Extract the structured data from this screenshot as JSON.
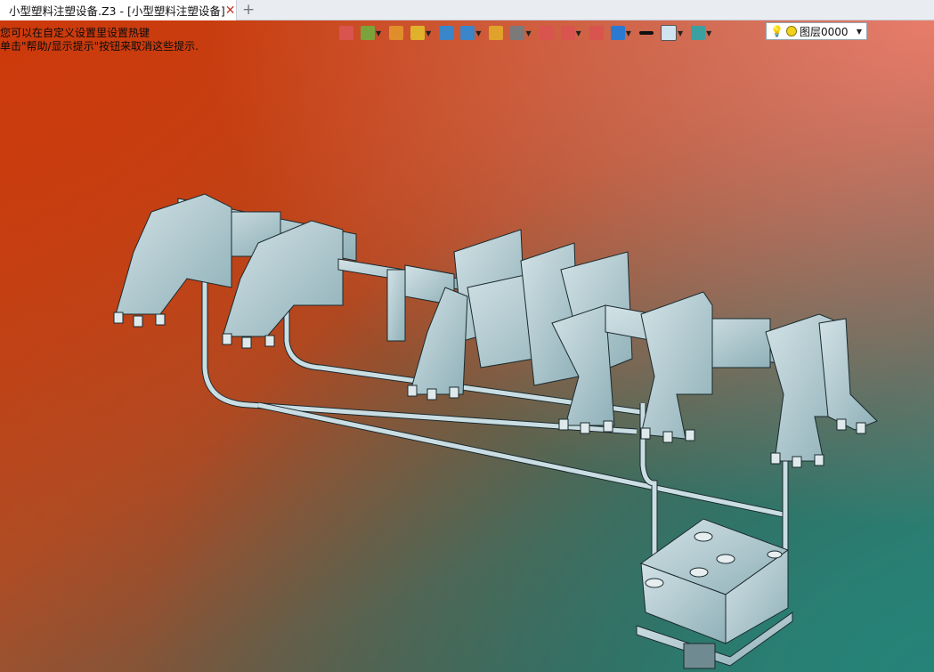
{
  "tab": {
    "title": "小型塑料注塑设备.Z3 - [小型塑料注塑设备]",
    "close_glyph": "✕"
  },
  "new_tab_glyph": "+",
  "hints": {
    "line1": "您可以在自定义设置里设置热键",
    "line2": "单击\"帮助/显示提示\"按钮来取消这些提示."
  },
  "toolbar": {
    "items": [
      {
        "icon": "insert-component-icon",
        "color": "#d9534f"
      },
      {
        "icon": "move-icon",
        "color": "#7aa33b"
      },
      {
        "icon": "pencil-icon",
        "color": "#e08e2b"
      },
      {
        "icon": "solid-block-icon",
        "color": "#e0b22b"
      },
      {
        "icon": "cube-icon",
        "color": "#3a86c8"
      },
      {
        "icon": "view-cube-icon",
        "color": "#3a86c8"
      },
      {
        "icon": "render-mode-icon",
        "color": "#e0a22b"
      },
      {
        "icon": "zoom-icon",
        "color": "#7a7a7a"
      },
      {
        "icon": "target-icon",
        "color": "#d9534f"
      },
      {
        "icon": "frame-icon",
        "color": "#d9534f"
      },
      {
        "icon": "bracket-icon",
        "color": "#d9534f"
      },
      {
        "icon": "display-icon",
        "color": "#2b7ad0"
      },
      {
        "icon": "line-color-icon",
        "color": "#111111"
      },
      {
        "icon": "face-color-icon",
        "color": "#cfe3f0"
      },
      {
        "icon": "layer-tools-icon",
        "color": "#3aa0a0"
      }
    ],
    "layer_label": "图层0000"
  }
}
